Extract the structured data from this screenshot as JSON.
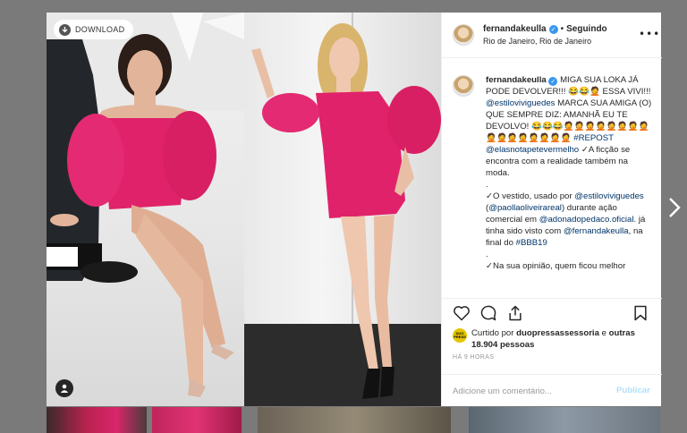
{
  "background": {
    "overlay_color": "#7a7a7a",
    "next_arrow_icon": "chevron-right-icon"
  },
  "media": {
    "download_label": "DOWNLOAD",
    "download_icon": "download-icon",
    "tag_icon": "user-tag-icon"
  },
  "header": {
    "username": "fernandakeulla",
    "verified_icon": "verified-badge-icon",
    "separator": "•",
    "follow_state": "Seguindo",
    "location": "Rio de Janeiro, Rio de Janeiro",
    "more_icon": "more-options-icon"
  },
  "caption": {
    "username": "fernandakeulla",
    "line1": "MIGA SUA LOKA JÁ PODE DEVOLVER!!! 😂😂🤦 ESSA VIVI!!!",
    "mention1": "@estiloviviguedes",
    "line2": "MARCA SUA AMIGA (O) QUE SEMPRE DIZ: AMANHÃ EU TE DEVOLVO! 😂😂😂🤦🤦🤦🤦🤦🤦🤦🤦🤦🤦🤦🤦🤦🤦🤦🤦",
    "tag_repost": "#REPOST",
    "mention2": "@elasnotapetevermelho",
    "line3": "✓A ficção se encontra com a realidade também na moda.",
    "dot1": ".",
    "line4": "✓O vestido, usado por",
    "mention3": "@estiloviviguedes",
    "line5a": "(",
    "mention4": "@paollaoliveirareal",
    "line5b": ") durante ação comercial em",
    "mention5": "@adonadopedaco.oficial",
    "line6": ". já tinha sido visto com",
    "mention6": "@fernandakeulla",
    "line7": ", na final do",
    "tag_bbb": "#BBB19",
    "dot2": ".",
    "dot3": ".",
    "line8": "✓Na sua opinião, quem ficou melhor"
  },
  "actions": {
    "like_icon": "heart-icon",
    "comment_icon": "comment-icon",
    "share_icon": "share-icon",
    "save_icon": "bookmark-icon",
    "likes_avatar_label": "DUO PRESS",
    "likes_prefix": "Curtido por",
    "likes_user": "duopressassessoria",
    "likes_and": "e",
    "likes_others": "outras 18.904 pessoas",
    "timestamp": "HÁ 9 HORAS"
  },
  "comment": {
    "placeholder": "Adicione um comentário...",
    "publish_label": "Publicar"
  },
  "colors": {
    "link": "#003569",
    "verified": "#3897f0",
    "publish_disabled": "#b2dffc",
    "dress_pink": "#e0226a"
  }
}
